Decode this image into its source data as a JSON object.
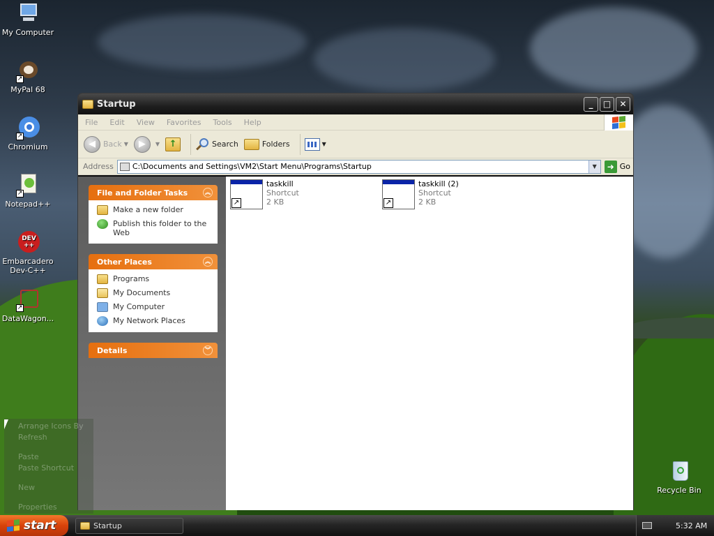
{
  "desktop": {
    "icons": [
      {
        "label": "My Computer"
      },
      {
        "label": "MyPal 68"
      },
      {
        "label": "Chromium"
      },
      {
        "label": "Notepad++"
      },
      {
        "label": "Embarcadero\nDev-C++"
      },
      {
        "label": "DataWagon..."
      },
      {
        "label": "Recycle Bin"
      }
    ]
  },
  "window": {
    "title": "Startup",
    "menu": [
      "File",
      "Edit",
      "View",
      "Favorites",
      "Tools",
      "Help"
    ],
    "toolbar": {
      "back_label": "Back",
      "search_label": "Search",
      "folders_label": "Folders"
    },
    "address": {
      "label": "Address",
      "value": "C:\\Documents and Settings\\VM2\\Start Menu\\Programs\\Startup",
      "go_label": "Go"
    },
    "panels": {
      "file_tasks": {
        "title": "File and Folder Tasks",
        "items": [
          "Make a new folder",
          "Publish this folder to the Web"
        ]
      },
      "other_places": {
        "title": "Other Places",
        "items": [
          "Programs",
          "My Documents",
          "My Computer",
          "My Network Places"
        ]
      },
      "details": {
        "title": "Details"
      }
    },
    "files": [
      {
        "name": "taskkill",
        "type": "Shortcut",
        "size": "2 KB"
      },
      {
        "name": "taskkill (2)",
        "type": "Shortcut",
        "size": "2 KB"
      }
    ]
  },
  "context_menu": {
    "items": [
      "Arrange Icons By",
      "Refresh",
      "Paste",
      "Paste Shortcut",
      "New",
      "Properties"
    ]
  },
  "taskbar": {
    "start_label": "start",
    "task_label": "Startup",
    "clock": "5:32 AM"
  }
}
